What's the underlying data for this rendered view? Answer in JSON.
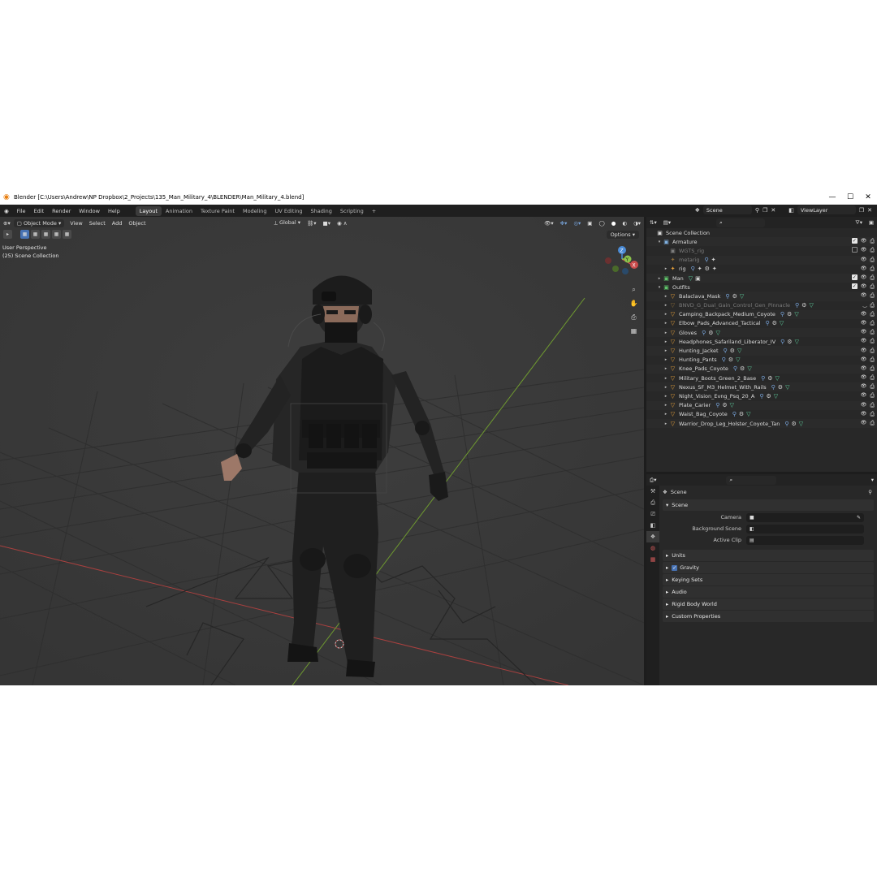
{
  "window": {
    "title": "Blender [C:\\Users\\Andrew\\NP Dropbox\\2_Projects\\135_Man_Military_4\\BLENDER\\Man_Military_4.blend]",
    "controls": [
      "—",
      "☐",
      "✕"
    ]
  },
  "menu": [
    "File",
    "Edit",
    "Render",
    "Window",
    "Help"
  ],
  "workspaces": [
    {
      "label": "Layout",
      "active": true
    },
    {
      "label": "Animation"
    },
    {
      "label": "Texture Paint"
    },
    {
      "label": "Modeling"
    },
    {
      "label": "UV Editing"
    },
    {
      "label": "Shading"
    },
    {
      "label": "Scripting"
    }
  ],
  "add_workspace": "+",
  "scene_field": "Scene",
  "viewlayer_field": "ViewLayer",
  "viewport": {
    "mode": "Object Mode",
    "menus": [
      "View",
      "Select",
      "Add",
      "Object"
    ],
    "transform": "Global",
    "perspective": "User Perspective",
    "collection_info": "(25) Scene Collection",
    "options": "Options",
    "gizmo": {
      "x": "X",
      "y": "Y",
      "z": "Z"
    }
  },
  "outliner": {
    "rows": [
      {
        "name": "Scene Collection",
        "indent": 0,
        "icon": "▣",
        "icon_color": "#d8d8d8",
        "tri": ""
      },
      {
        "name": "Armature",
        "indent": 1,
        "icon": "▣",
        "icon_color": "#7fb0e0",
        "tri": "▾",
        "chk": true,
        "eye": true,
        "cam": true
      },
      {
        "name": "WGTS_rig",
        "indent": 2,
        "icon": "▣",
        "icon_color": "#7c7c7c",
        "tri": "",
        "dim": true,
        "chk_off": true,
        "eye": true,
        "cam": true
      },
      {
        "name": "metarig",
        "indent": 2,
        "icon": "✦",
        "icon_color": "#8a6a3a",
        "tri": "",
        "dim": true,
        "extras": [
          "⚲",
          "✦"
        ],
        "eye": true,
        "cam": true
      },
      {
        "name": "rig",
        "indent": 2,
        "icon": "✦",
        "icon_color": "#e8a13a",
        "tri": "▸",
        "extras": [
          "⚲",
          "✦",
          "⚙",
          "✦"
        ],
        "eye": true,
        "cam": true
      },
      {
        "name": "Man",
        "indent": 1,
        "icon": "▣",
        "icon_color": "#5fc36a",
        "tri": "▸",
        "extras": [
          "▽",
          "▣"
        ],
        "chk": true,
        "eye": true,
        "cam": true
      },
      {
        "name": "Outfits",
        "indent": 1,
        "icon": "▣",
        "icon_color": "#5fc36a",
        "tri": "▾",
        "chk": true,
        "eye": true,
        "cam": true
      },
      {
        "name": "Balaclava_Mask",
        "indent": 2,
        "icon": "▽",
        "icon_color": "#e8a13a",
        "tri": "▸",
        "extras": [
          "⚲",
          "⚙",
          "▽"
        ],
        "eye": true,
        "cam": true
      },
      {
        "name": "BNVD_G_Dual_Gain_Control_Gen_Pinnacle",
        "indent": 2,
        "icon": "▽",
        "icon_color": "#8a6a3a",
        "tri": "▸",
        "dim": true,
        "extras": [
          "⚲",
          "⚙",
          "▽"
        ],
        "eye_off": true,
        "cam": true
      },
      {
        "name": "Camping_Backpack_Medium_Coyote",
        "indent": 2,
        "icon": "▽",
        "icon_color": "#e8a13a",
        "tri": "▸",
        "extras": [
          "⚲",
          "⚙",
          "▽"
        ],
        "eye": true,
        "cam": true
      },
      {
        "name": "Elbow_Pads_Advanced_Tactical",
        "indent": 2,
        "icon": "▽",
        "icon_color": "#e8a13a",
        "tri": "▸",
        "extras": [
          "⚲",
          "⚙",
          "▽"
        ],
        "eye": true,
        "cam": true
      },
      {
        "name": "Gloves",
        "indent": 2,
        "icon": "▽",
        "icon_color": "#e8a13a",
        "tri": "▸",
        "extras": [
          "⚲",
          "⚙",
          "▽"
        ],
        "eye": true,
        "cam": true
      },
      {
        "name": "Headphones_Safariland_Liberator_IV",
        "indent": 2,
        "icon": "▽",
        "icon_color": "#e8a13a",
        "tri": "▸",
        "extras": [
          "⚲",
          "⚙",
          "▽"
        ],
        "eye": true,
        "cam": true
      },
      {
        "name": "Hunting_Jacket",
        "indent": 2,
        "icon": "▽",
        "icon_color": "#e8a13a",
        "tri": "▸",
        "extras": [
          "⚲",
          "⚙",
          "▽"
        ],
        "eye": true,
        "cam": true
      },
      {
        "name": "Hunting_Pants",
        "indent": 2,
        "icon": "▽",
        "icon_color": "#e8a13a",
        "tri": "▸",
        "extras": [
          "⚲",
          "⚙",
          "▽"
        ],
        "eye": true,
        "cam": true
      },
      {
        "name": "Knee_Pads_Coyote",
        "indent": 2,
        "icon": "▽",
        "icon_color": "#e8a13a",
        "tri": "▸",
        "extras": [
          "⚲",
          "⚙",
          "▽"
        ],
        "eye": true,
        "cam": true
      },
      {
        "name": "Military_Boots_Green_2_Base",
        "indent": 2,
        "icon": "▽",
        "icon_color": "#e8a13a",
        "tri": "▸",
        "extras": [
          "⚲",
          "⚙",
          "▽"
        ],
        "eye": true,
        "cam": true
      },
      {
        "name": "Nexus_SF_M3_Helmet_With_Rails",
        "indent": 2,
        "icon": "▽",
        "icon_color": "#e8a13a",
        "tri": "▸",
        "extras": [
          "⚲",
          "⚙",
          "▽"
        ],
        "eye": true,
        "cam": true
      },
      {
        "name": "Night_Vision_Evng_Psq_20_A",
        "indent": 2,
        "icon": "▽",
        "icon_color": "#e8a13a",
        "tri": "▸",
        "extras": [
          "⚲",
          "⚙",
          "▽"
        ],
        "eye": true,
        "cam": true
      },
      {
        "name": "Plate_Carier",
        "indent": 2,
        "icon": "▽",
        "icon_color": "#e8a13a",
        "tri": "▸",
        "extras": [
          "⚲",
          "⚙",
          "▽"
        ],
        "eye": true,
        "cam": true
      },
      {
        "name": "Waist_Bag_Coyote",
        "indent": 2,
        "icon": "▽",
        "icon_color": "#e8a13a",
        "tri": "▸",
        "extras": [
          "⚲",
          "⚙",
          "▽"
        ],
        "eye": true,
        "cam": true
      },
      {
        "name": "Warrior_Drop_Leg_Holster_Coyote_Tan",
        "indent": 2,
        "icon": "▽",
        "icon_color": "#e8a13a",
        "tri": "▸",
        "extras": [
          "⚲",
          "⚙",
          "▽"
        ],
        "eye": true,
        "cam": true
      }
    ]
  },
  "properties": {
    "context": "Scene",
    "panel": "Scene",
    "fields": [
      {
        "label": "Camera",
        "icon": "■",
        "value": ""
      },
      {
        "label": "Background Scene",
        "icon": "◧",
        "value": ""
      },
      {
        "label": "Active Clip",
        "icon": "▤",
        "value": ""
      }
    ],
    "collapsed_panels": [
      "Units",
      "Gravity",
      "Keying Sets",
      "Audio",
      "Rigid Body World",
      "Custom Properties"
    ],
    "gravity_checked": true
  },
  "colors": {
    "accent": "#4772b3",
    "x_axis": "#c94c4c",
    "y_axis": "#8bc34a",
    "z_axis": "#4a8bd6",
    "object_icon": "#e8a13a",
    "collection_icon": "#5fc36a"
  }
}
